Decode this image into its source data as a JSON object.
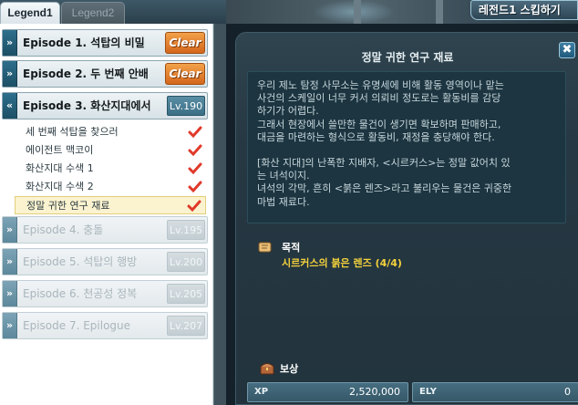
{
  "tabs": [
    {
      "label": "Legend1",
      "active": true
    },
    {
      "label": "Legend2",
      "active": false
    }
  ],
  "legend_badge": "레전드1 스킵하기",
  "episodes": [
    {
      "title": "Episode 1. 석탑의 비밀",
      "status": "Clear"
    },
    {
      "title": "Episode 2. 두 번째 안배",
      "status": "Clear"
    },
    {
      "title": "Episode 3. 화산지대에서",
      "level": "Lv.190",
      "subquests": [
        {
          "title": "세 번째 석탑을 찾으러",
          "completed": true
        },
        {
          "title": "에이전트 맥코이",
          "completed": true
        },
        {
          "title": "화산지대 수색 1",
          "completed": true
        },
        {
          "title": "화산지대 수색 2",
          "completed": true
        },
        {
          "title": "정말 귀한 연구 재료",
          "completed": true,
          "selected": true
        }
      ]
    },
    {
      "title": "Episode 4. 충돌",
      "level": "Lv.195"
    },
    {
      "title": "Episode 5. 석탑의 행방",
      "level": "Lv.200"
    },
    {
      "title": "Episode 6. 천공성 정복",
      "level": "Lv.205"
    },
    {
      "title": "Episode 7. Epilogue",
      "level": "Lv.207"
    }
  ],
  "quest": {
    "title": "정말 귀한 연구 재료",
    "close_label": "✖",
    "description": {
      "para1": [
        "우리 제노 탐정 사무소는 유명세에 비해 활동 영역이나 맡는",
        "사건의 스케일이 너무 커서 의뢰비 정도로는 활동비를 감당",
        "하기가 어렵다.",
        "그래서 현장에서 쓸만한 물건이 생기면 확보하며 판매하고,",
        "대금을 마련하는 형식으로 활동비, 재정을 충당해야 한다."
      ],
      "para2": [
        "[화산 지대]의 난폭한 지배자, <시르커스>는 정말 값어치 있",
        "는 녀석이지.",
        "녀석의 각막, 흔히 <붉은 렌즈>라고 불리우는 물건은 귀중한",
        " 마법 재료다."
      ]
    },
    "objective_label": "목적",
    "objective": "시르커스의 붉은 렌즈 (4/4)",
    "reward_label": "보상",
    "rewards": {
      "xp_label": "XP",
      "xp_value": "2,520,000",
      "ely_label": "ELY",
      "ely_value": "0"
    }
  },
  "colors": {
    "accent_clear": "#d4661b",
    "objective": "#f4d23c",
    "check": "#e0392a"
  }
}
